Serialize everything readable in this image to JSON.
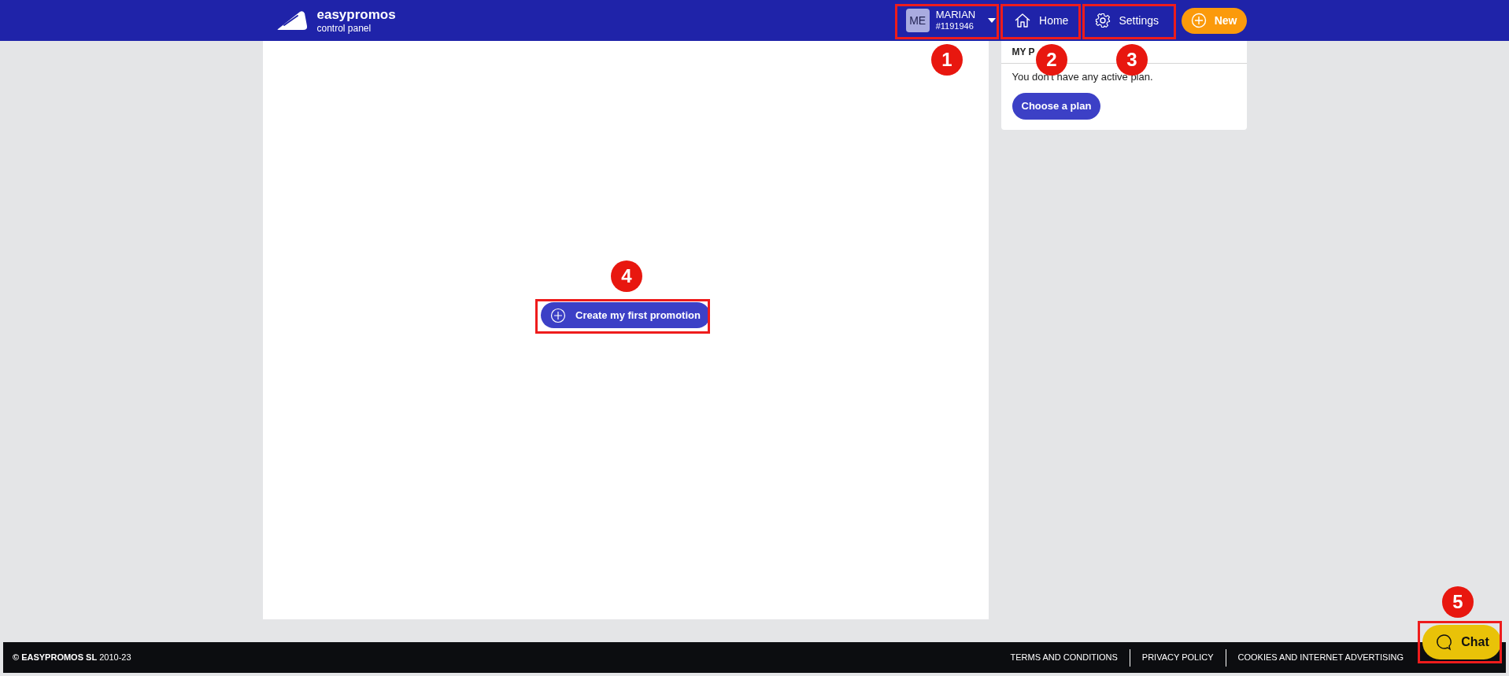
{
  "header": {
    "logo": {
      "name": "easypromos",
      "subtitle": "control panel"
    },
    "user": {
      "initials": "ME",
      "name": "MARIAN",
      "id": "#1191946"
    },
    "nav": [
      {
        "label": "Home",
        "kind": "home"
      },
      {
        "label": "Settings",
        "kind": "gear"
      }
    ],
    "new_button": "New"
  },
  "main": {
    "create_button": "Create my first promotion"
  },
  "plan_card": {
    "title": "MY P",
    "message": "You don't have any active plan.",
    "button": "Choose a plan"
  },
  "footer": {
    "copyright": "**© EASYPROMOS SL** 2010-23",
    "links": [
      "TERMS AND CONDITIONS",
      "PRIVACY POLICY",
      "COOKIES AND INTERNET ADVERTISING"
    ]
  },
  "chat_button": "Chat",
  "annotations": [
    {
      "number": "1"
    },
    {
      "number": "2"
    },
    {
      "number": "3"
    },
    {
      "number": "4"
    },
    {
      "number": "5"
    }
  ]
}
